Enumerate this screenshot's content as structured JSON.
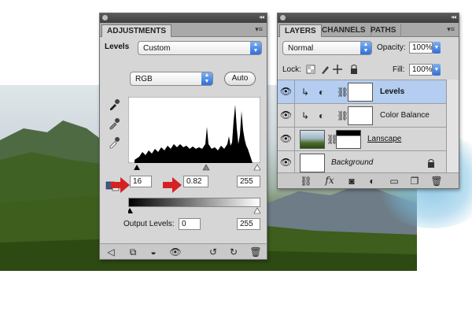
{
  "adjustments": {
    "tab_label": "ADJUSTMENTS",
    "adjustment_name": "Levels",
    "preset": "Custom",
    "channel": "RGB",
    "auto_label": "Auto",
    "input_black": "16",
    "input_gamma": "0.82",
    "input_white": "255",
    "output_levels_label": "Output Levels:",
    "output_black": "0",
    "output_white": "255"
  },
  "layers_panel": {
    "tabs": [
      "LAYERS",
      "CHANNELS",
      "PATHS"
    ],
    "blend_mode": "Normal",
    "opacity_label": "Opacity:",
    "opacity_value": "100%",
    "lock_label": "Lock:",
    "fill_label": "Fill:",
    "fill_value": "100%",
    "layers": [
      {
        "name": "Levels",
        "selected": true
      },
      {
        "name": "Color Balance",
        "selected": false
      },
      {
        "name": "Lanscape",
        "selected": false
      },
      {
        "name": "Background",
        "selected": false
      }
    ]
  },
  "icons": {
    "eyedroppers": [
      "eyedropper-black-icon",
      "eyedropper-gray-icon",
      "eyedropper-white-icon"
    ],
    "adjustment_footer": [
      "back-arrow-icon",
      "clip-icon",
      "mask-toggle-icon",
      "visibility-icon",
      "previous-state-icon",
      "reset-icon",
      "trash-icon"
    ],
    "layers_footer": [
      "link-icon",
      "fx-icon",
      "mask-icon",
      "adjustment-layer-icon",
      "group-icon",
      "new-layer-icon",
      "trash-icon"
    ]
  },
  "colors": {
    "annotation_arrow": "#d42222",
    "selected_layer": "#b4cdf0",
    "select_arrow": "#2f6fd8"
  }
}
